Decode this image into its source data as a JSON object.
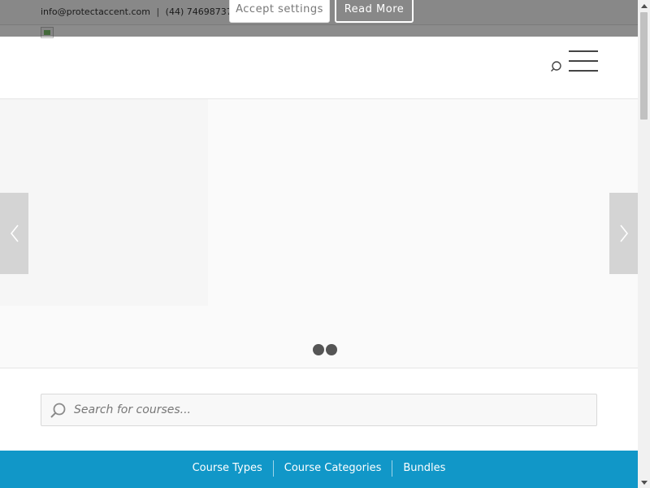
{
  "topbar": {
    "email": "info@protectaccent.com",
    "separator": "|",
    "phone": "(44) 7469873735"
  },
  "cookie_bar": {
    "accept_label": "Accept settings",
    "read_more_label": "Read More"
  },
  "header": {
    "search_icon": "search-icon",
    "menu_icon": "hamburger-menu-icon"
  },
  "slider": {
    "prev_icon": "chevron-left-icon",
    "next_icon": "chevron-right-icon",
    "slide_count": 2
  },
  "course_search": {
    "placeholder": "Search for courses...",
    "value": ""
  },
  "nav": {
    "items": [
      {
        "label": "Course Types"
      },
      {
        "label": "Course Categories"
      },
      {
        "label": "Bundles"
      }
    ]
  },
  "colors": {
    "nav_background": "#1197c8",
    "overlay": "rgba(0,0,0,0.45)"
  }
}
